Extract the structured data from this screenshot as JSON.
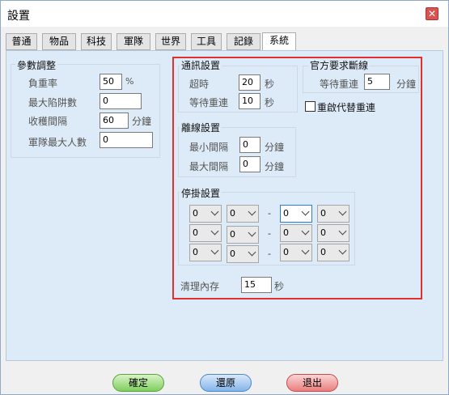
{
  "window": {
    "title": "設置"
  },
  "tabs": [
    "普通",
    "物品",
    "科技",
    "軍隊",
    "世界",
    "工具",
    "記錄",
    "系統"
  ],
  "params": {
    "title": "參數調整",
    "load_label": "負重率",
    "load_value": "50",
    "load_unit": "%",
    "trap_label": "最大陷阱數",
    "trap_value": "0",
    "collect_label": "收穫間隔",
    "collect_value": "60",
    "collect_unit": "分鐘",
    "army_label": "軍隊最大人數",
    "army_value": "0"
  },
  "comm": {
    "title": "通訊設置",
    "timeout_label": "超時",
    "timeout_value": "20",
    "timeout_unit": "秒",
    "wait_label": "等待重連",
    "wait_value": "10",
    "wait_unit": "秒"
  },
  "official": {
    "title": "官方要求斷線",
    "wait_label": "等待重連",
    "wait_value": "5",
    "wait_unit": "分鐘",
    "replace_label": "重啟代替重連"
  },
  "offline": {
    "title": "離線設置",
    "min_label": "最小間隔",
    "min_value": "0",
    "min_unit": "分鐘",
    "max_label": "最大間隔",
    "max_value": "0",
    "max_unit": "分鐘"
  },
  "hang": {
    "title": "停掛設置",
    "rows": [
      [
        "0",
        "0",
        "0",
        "0"
      ],
      [
        "0",
        "0",
        "0",
        "0"
      ],
      [
        "0",
        "0",
        "0",
        "0"
      ]
    ],
    "separator": "-"
  },
  "memory": {
    "label": "清理內存",
    "value": "15",
    "unit": "秒"
  },
  "buttons": {
    "ok": "確定",
    "restore": "還原",
    "exit": "退出"
  }
}
